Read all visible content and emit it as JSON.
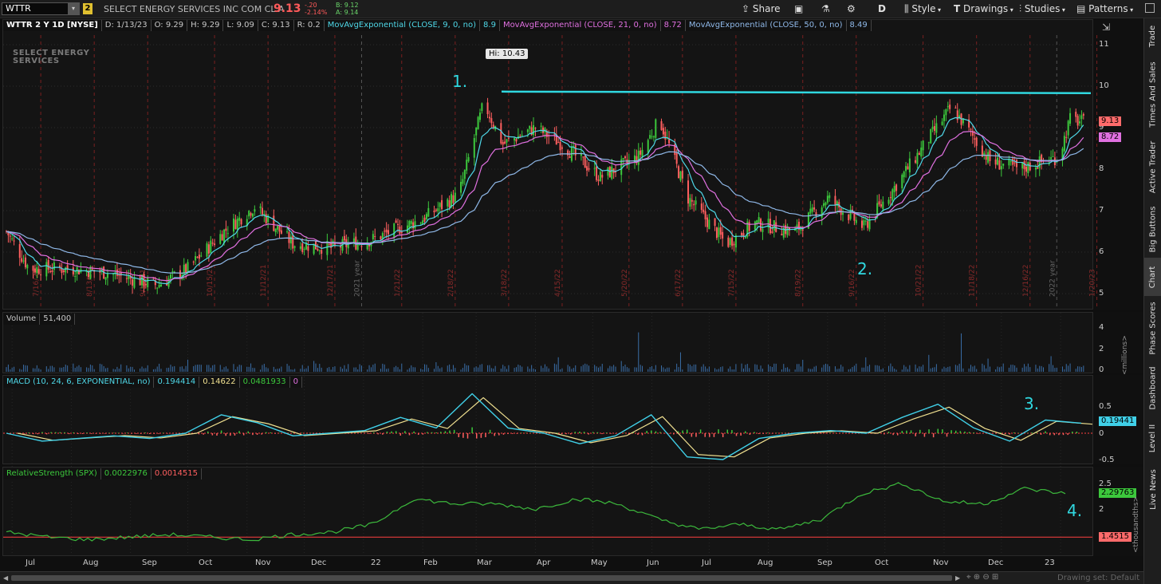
{
  "toolbar": {
    "symbol": "WTTR",
    "link_number": "2",
    "company": "SELECT ENERGY SERVICES INC COM CL A",
    "last": "9.13",
    "change": "-.20",
    "change_pct": "-2.14%",
    "bid": "B: 9.12",
    "ask": "A: 9.14",
    "share_label": "Share",
    "aggregation": "D",
    "style_label": "Style",
    "drawings_label": "Drawings",
    "studies_label": "Studies",
    "patterns_label": "Patterns"
  },
  "chart_header": {
    "title": "WTTR 2 Y 1D [NYSE]",
    "date": "D: 1/13/23",
    "open": "O: 9.29",
    "high": "H: 9.29",
    "low": "L: 9.09",
    "close": "C: 9.13",
    "range": "R: 0.2",
    "ema9_label": "MovAvgExponential (CLOSE, 9, 0, no)",
    "ema9_value": "8.9",
    "ema21_label": "MovAvgExponential (CLOSE, 21, 0, no)",
    "ema21_value": "8.72",
    "ema50_label": "MovAvgExponential (CLOSE, 50, 0, no)",
    "ema50_value": "8.49"
  },
  "logo_text": "SELECT ENERGY SERVICES",
  "annotations": {
    "hi_label": "Hi: 10.43",
    "n1": "1.",
    "n2": "2.",
    "n3": "3.",
    "n4": "4."
  },
  "price_axis": [
    "11",
    "10",
    "9",
    "8",
    "7",
    "6",
    "5"
  ],
  "price_tags": {
    "last": "9.13",
    "ema": "8.72"
  },
  "volume_pane": {
    "label": "Volume",
    "value": "51,400",
    "axis": [
      "4",
      "2",
      "0"
    ],
    "unit": "<millions>"
  },
  "macd_pane": {
    "label": "MACD (10, 24, 6, EXPONENTIAL, no)",
    "v1": "0.194414",
    "v2": "0.14622",
    "v3": "0.0481933",
    "v4": "0",
    "axis": [
      "0.5",
      "0",
      "-0.5"
    ],
    "tag": "0.19441"
  },
  "rs_pane": {
    "label": "RelativeStrength (SPX)",
    "v1": "0.0022976",
    "v2": "0.0014515",
    "axis": [
      "2.5",
      "2"
    ],
    "tag_green": "2.29763",
    "tag_red": "1.4515",
    "unit": "<thousandths>"
  },
  "months": [
    "Jul",
    "Aug",
    "Sep",
    "Oct",
    "Nov",
    "Dec",
    "22",
    "Feb",
    "Mar",
    "Apr",
    "May",
    "Jun",
    "Jul",
    "Aug",
    "Sep",
    "Oct",
    "Nov",
    "Dec",
    "23"
  ],
  "date_markers": [
    "7/16/21",
    "8/13/21",
    "9/10/21",
    "10/15/21",
    "11/12/21",
    "12/17/21",
    "2021 year",
    "1/21/22",
    "2/18/22",
    "3/18/22",
    "4/15/22",
    "5/20/22",
    "6/17/22",
    "7/15/22",
    "8/19/22",
    "9/16/22",
    "10/21/22",
    "11/18/22",
    "12/16/22",
    "2022 year",
    "1/20/23"
  ],
  "side_tabs": [
    "Trade",
    "Times And Sales",
    "Active Trader",
    "Big Buttons",
    "Chart",
    "Phase Scores",
    "Dashboard",
    "Level II",
    "Live News"
  ],
  "status": {
    "drawing_set": "Drawing set: Default"
  },
  "colors": {
    "up": "#3cc83c",
    "down": "#ff5f5f",
    "ema9": "#4fd8e8",
    "ema21": "#e070e0",
    "ema50": "#8fb8e8",
    "resistance": "#30d8e0",
    "rs_line": "#3cb83c",
    "macd": "#40d0e8",
    "signal": "#f0e090"
  },
  "chart_data": {
    "type": "candlestick",
    "title": "WTTR 2 Y 1D [NYSE]",
    "price_range": [
      4.8,
      11.4
    ],
    "resistance_level": 9.85,
    "high_marker": 10.43,
    "close_path": [
      [
        "2021-06-28",
        6.5
      ],
      [
        "2021-07-10",
        5.6
      ],
      [
        "2021-08-01",
        5.6
      ],
      [
        "2021-08-20",
        5.5
      ],
      [
        "2021-09-15",
        5.2
      ],
      [
        "2021-10-01",
        5.6
      ],
      [
        "2021-10-20",
        6.5
      ],
      [
        "2021-11-05",
        7.1
      ],
      [
        "2021-11-25",
        6.2
      ],
      [
        "2021-12-15",
        6.1
      ],
      [
        "2022-01-05",
        6.3
      ],
      [
        "2022-02-01",
        6.8
      ],
      [
        "2022-02-20",
        7.4
      ],
      [
        "2022-03-05",
        9.6
      ],
      [
        "2022-03-15",
        8.6
      ],
      [
        "2022-04-01",
        9.0
      ],
      [
        "2022-04-15",
        8.6
      ],
      [
        "2022-05-05",
        7.8
      ],
      [
        "2022-05-25",
        8.3
      ],
      [
        "2022-06-05",
        9.2
      ],
      [
        "2022-06-20",
        7.3
      ],
      [
        "2022-07-10",
        6.2
      ],
      [
        "2022-07-25",
        6.7
      ],
      [
        "2022-08-15",
        6.5
      ],
      [
        "2022-09-01",
        7.3
      ],
      [
        "2022-09-20",
        6.6
      ],
      [
        "2022-10-05",
        7.5
      ],
      [
        "2022-10-25",
        8.8
      ],
      [
        "2022-11-05",
        9.5
      ],
      [
        "2022-11-25",
        8.2
      ],
      [
        "2022-12-10",
        8.0
      ],
      [
        "2022-12-31",
        8.3
      ],
      [
        "2023-01-06",
        9.2
      ],
      [
        "2023-01-13",
        9.13
      ]
    ],
    "macd_range": [
      -0.6,
      0.9
    ],
    "macd_path": [
      0.0,
      -0.15,
      -0.1,
      -0.05,
      -0.1,
      0.0,
      0.35,
      0.2,
      -0.05,
      0.0,
      0.05,
      0.3,
      0.1,
      0.75,
      0.1,
      0.0,
      -0.2,
      -0.05,
      0.35,
      -0.45,
      -0.5,
      -0.1,
      0.0,
      0.05,
      0.0,
      0.3,
      0.55,
      0.1,
      -0.15,
      0.25,
      0.19
    ],
    "rs_range": [
      1.3,
      2.6
    ],
    "rs_path": [
      1.55,
      1.45,
      1.4,
      1.45,
      1.5,
      1.45,
      1.4,
      1.5,
      1.55,
      1.7,
      2.2,
      2.1,
      2.1,
      2.0,
      2.2,
      2.1,
      1.8,
      1.6,
      1.7,
      1.6,
      1.8,
      2.3,
      2.5,
      2.15,
      2.1,
      2.4,
      2.3
    ]
  }
}
